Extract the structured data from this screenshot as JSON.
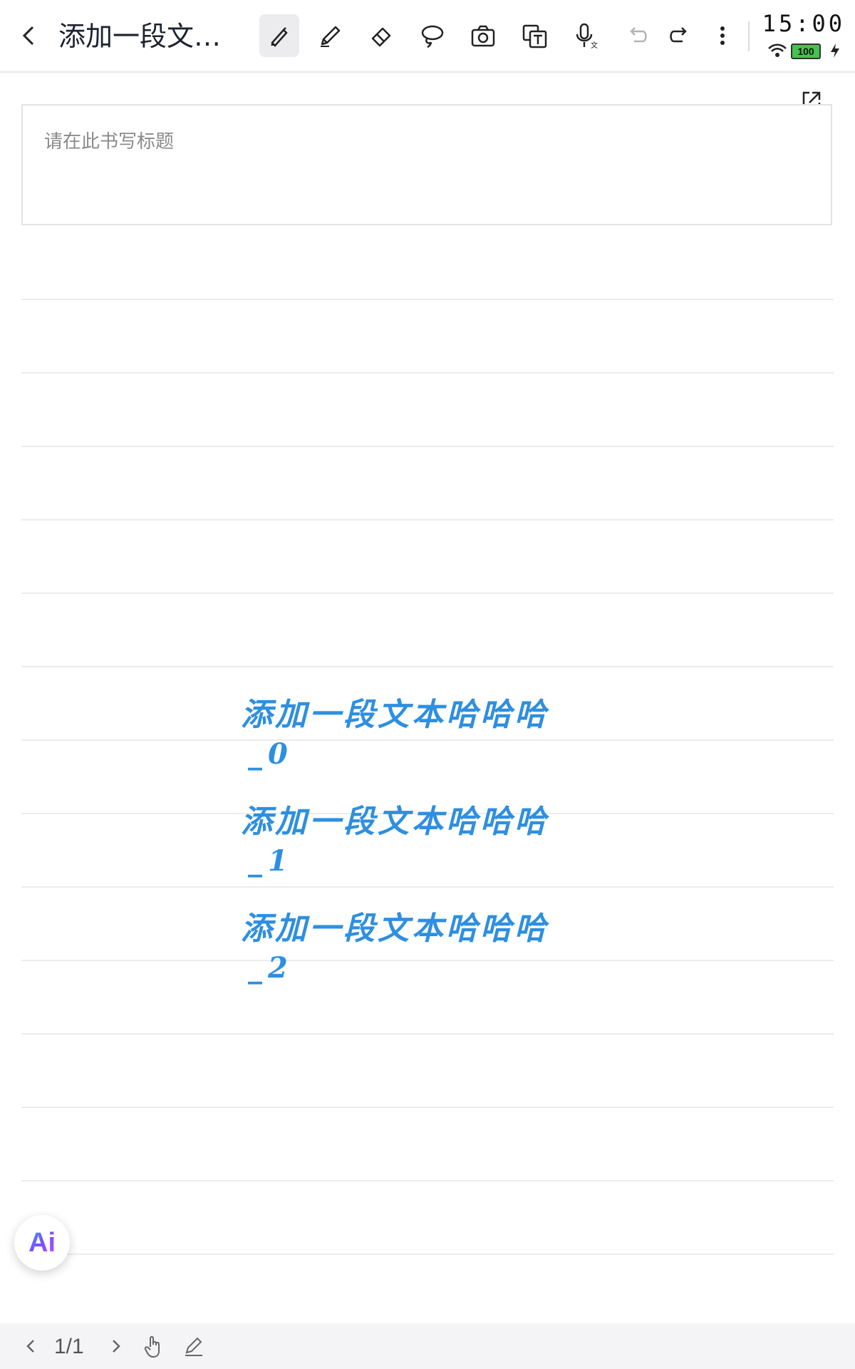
{
  "toolbar": {
    "title": "添加一段文本...",
    "tools": [
      {
        "name": "brush-pen-icon",
        "active": true
      },
      {
        "name": "pencil-icon",
        "active": false
      },
      {
        "name": "eraser-icon",
        "active": false
      },
      {
        "name": "lasso-icon",
        "active": false
      },
      {
        "name": "camera-icon",
        "active": false
      },
      {
        "name": "text-convert-icon",
        "active": false
      },
      {
        "name": "voice-to-text-icon",
        "active": false
      },
      {
        "name": "undo-icon",
        "active": false
      },
      {
        "name": "redo-icon",
        "active": false
      },
      {
        "name": "more-options-icon",
        "active": false
      }
    ]
  },
  "status": {
    "time": "15:00",
    "battery": "100"
  },
  "note": {
    "title_placeholder": "请在此书写标题",
    "handwriting": [
      {
        "line": "添加一段文本哈哈哈",
        "suffix": "_0"
      },
      {
        "line": "添加一段文本哈哈哈",
        "suffix": "_1"
      },
      {
        "line": "添加一段文本哈哈哈",
        "suffix": "_2"
      }
    ]
  },
  "ai_button": {
    "label": "Ai"
  },
  "footer": {
    "page_indicator": "1/1"
  },
  "colors": {
    "accent": "#2e8fe0",
    "battery": "#46c24e"
  }
}
